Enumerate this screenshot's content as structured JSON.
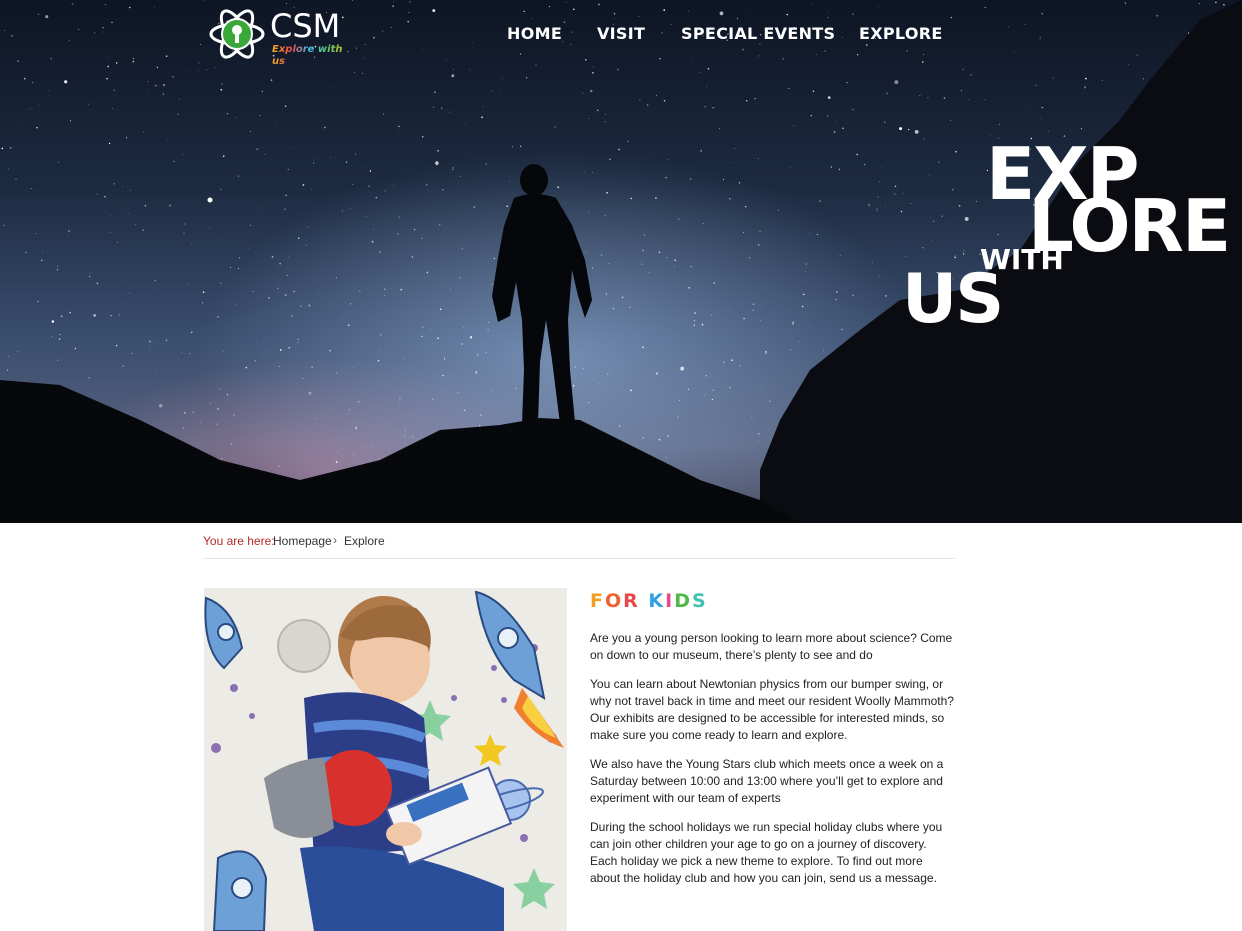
{
  "brand": {
    "name": "CSM",
    "tagline": "Explore with us"
  },
  "nav": {
    "items": [
      {
        "label": "HOME"
      },
      {
        "label": "VISIT"
      },
      {
        "label": "SPECIAL EVENTS"
      },
      {
        "label": "EXPLORE"
      }
    ]
  },
  "hero": {
    "line1": "EXP",
    "line2": "LORE",
    "line3": "WITH",
    "line4": "US"
  },
  "breadcrumb": {
    "label": "You are here:",
    "home": "Homepage",
    "current": "Explore"
  },
  "section": {
    "heading_letters": [
      {
        "ch": "F",
        "color": "#f0a020"
      },
      {
        "ch": "O",
        "color": "#f06030"
      },
      {
        "ch": "R",
        "color": "#e84848"
      },
      {
        "ch": " ",
        "color": "#ffffff"
      },
      {
        "ch": "K",
        "color": "#30a0e0"
      },
      {
        "ch": "I",
        "color": "#e84890"
      },
      {
        "ch": "D",
        "color": "#50b848"
      },
      {
        "ch": "S",
        "color": "#40c0b0"
      }
    ],
    "paragraphs": [
      "Are you a young person looking to learn more about science? Come on down to our museum, there’s plenty to see and do",
      "You can learn about Newtonian physics from our bumper swing, or why not travel back in time and meet our resident Woolly Mammoth? Our exhibits are designed to be accessible for interested minds, so make sure you come ready to learn and explore.",
      "We also have the Young Stars club which meets once a week on a Saturday between 10:00 and 13:00 where you’ll get to explore and experiment with our team of experts",
      "During the school holidays we run special holiday clubs where you can join other children your age to go on a journey of discovery. Each holiday we pick a new theme to explore. To find out more about the holiday club and how you can join, send us a message."
    ]
  },
  "colors": {
    "accent_red": "#b82a2a",
    "logo_green": "#3aa838"
  }
}
